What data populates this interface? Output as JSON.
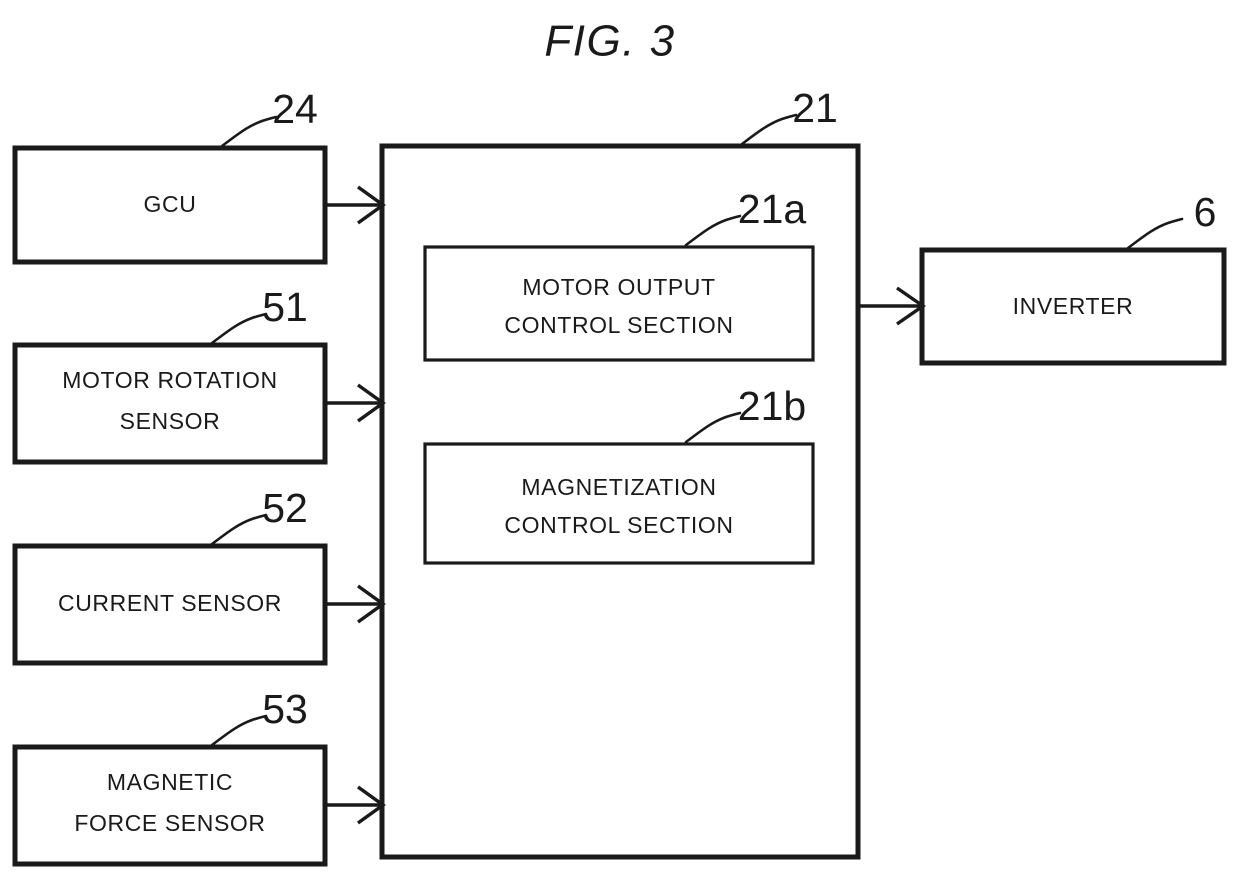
{
  "figure": {
    "title": "FIG. 3",
    "type": "patent-block-diagram"
  },
  "blocks": {
    "gcu": {
      "ref": "24",
      "label_line1": "GCU",
      "label_line2": ""
    },
    "motor_rotation_sensor": {
      "ref": "51",
      "label_line1": "MOTOR ROTATION",
      "label_line2": "SENSOR"
    },
    "current_sensor": {
      "ref": "52",
      "label_line1": "CURRENT SENSOR",
      "label_line2": ""
    },
    "magnetic_force_sensor": {
      "ref": "53",
      "label_line1": "MAGNETIC",
      "label_line2": "FORCE SENSOR"
    },
    "controller": {
      "ref": "21",
      "label_line1": "",
      "label_line2": ""
    },
    "motor_output_control_section": {
      "ref": "21a",
      "label_line1": "MOTOR OUTPUT",
      "label_line2": "CONTROL SECTION"
    },
    "magnetization_control_section": {
      "ref": "21b",
      "label_line1": "MAGNETIZATION",
      "label_line2": "CONTROL SECTION"
    },
    "inverter": {
      "ref": "6",
      "label_line1": "INVERTER",
      "label_line2": ""
    }
  },
  "connections": [
    {
      "from": "gcu",
      "to": "controller",
      "style": "arrow"
    },
    {
      "from": "motor_rotation_sensor",
      "to": "controller",
      "style": "arrow"
    },
    {
      "from": "current_sensor",
      "to": "controller",
      "style": "arrow"
    },
    {
      "from": "magnetic_force_sensor",
      "to": "controller",
      "style": "arrow"
    },
    {
      "from": "controller",
      "to": "inverter",
      "style": "arrow"
    }
  ],
  "colors": {
    "ink": "#1a1a1a",
    "paper": "#ffffff"
  }
}
